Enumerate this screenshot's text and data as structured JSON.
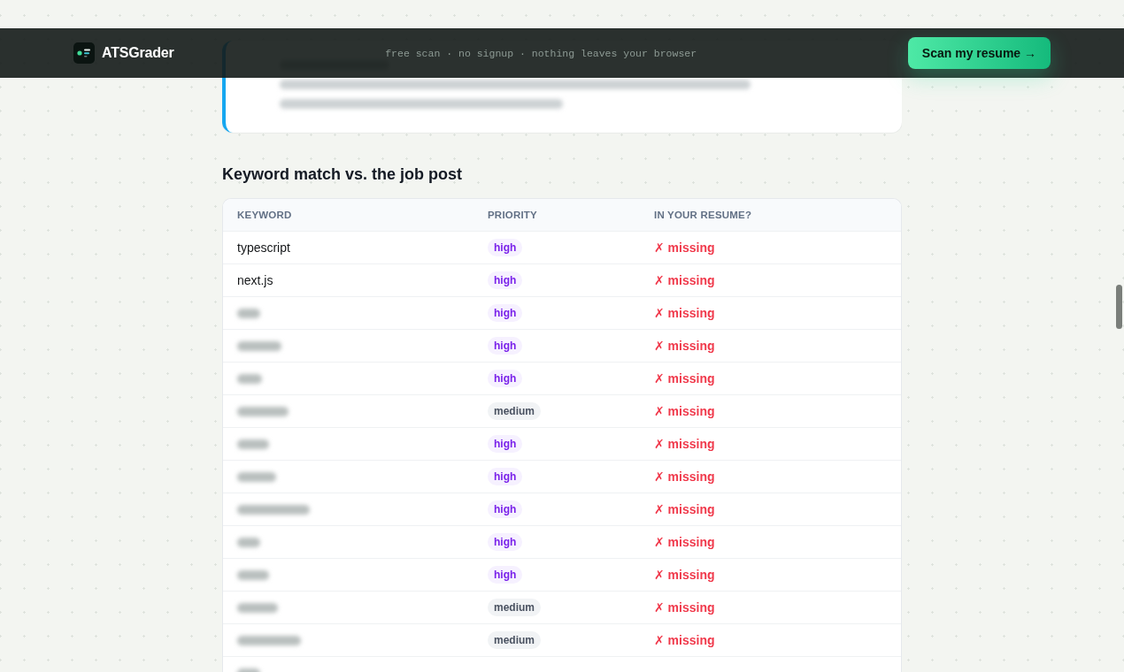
{
  "header": {
    "brand": "ATSGrader",
    "tagline": "free scan · no signup · nothing leaves your browser",
    "cta": "Scan my resume →"
  },
  "tip": {
    "blurred": true
  },
  "keywords": {
    "title": "Keyword match vs. the job post",
    "columns": [
      "KEYWORD",
      "PRIORITY",
      "IN YOUR RESUME?"
    ],
    "rows": [
      {
        "keyword": "typescript",
        "blurred": false,
        "priority": {
          "label": "high",
          "kind": "high"
        },
        "status": "✗ missing",
        "found": false
      },
      {
        "keyword": "next.js",
        "blurred": false,
        "priority": {
          "label": "high",
          "kind": "high"
        },
        "status": "✗ missing",
        "found": false
      },
      {
        "blurred": true,
        "priority": {
          "label": "high",
          "kind": "high"
        },
        "status": "✗ missing",
        "found": false
      },
      {
        "blurred": true,
        "priority": {
          "label": "high",
          "kind": "high"
        },
        "status": "✗ missing",
        "found": false
      },
      {
        "blurred": true,
        "priority": {
          "label": "high",
          "kind": "high"
        },
        "status": "✗ missing",
        "found": false
      },
      {
        "blurred": true,
        "priority": {
          "label": "medium",
          "kind": "medium"
        },
        "status": "✗ missing",
        "found": false
      },
      {
        "blurred": true,
        "priority": {
          "label": "high",
          "kind": "high"
        },
        "status": "✗ missing",
        "found": false
      },
      {
        "blurred": true,
        "priority": {
          "label": "high",
          "kind": "high"
        },
        "status": "✗ missing",
        "found": false
      },
      {
        "blurred": true,
        "priority": {
          "label": "high",
          "kind": "high"
        },
        "status": "✗ missing",
        "found": false
      },
      {
        "blurred": true,
        "priority": {
          "label": "high",
          "kind": "high"
        },
        "status": "✗ missing",
        "found": false
      },
      {
        "blurred": true,
        "priority": {
          "label": "high",
          "kind": "high"
        },
        "status": "✗ missing",
        "found": false
      },
      {
        "blurred": true,
        "priority": {
          "label": "medium",
          "kind": "medium"
        },
        "status": "✗ missing",
        "found": false
      },
      {
        "blurred": true,
        "priority": {
          "label": "medium",
          "kind": "medium"
        },
        "status": "✗ missing",
        "found": false
      },
      {
        "blurred": true
      }
    ]
  }
}
